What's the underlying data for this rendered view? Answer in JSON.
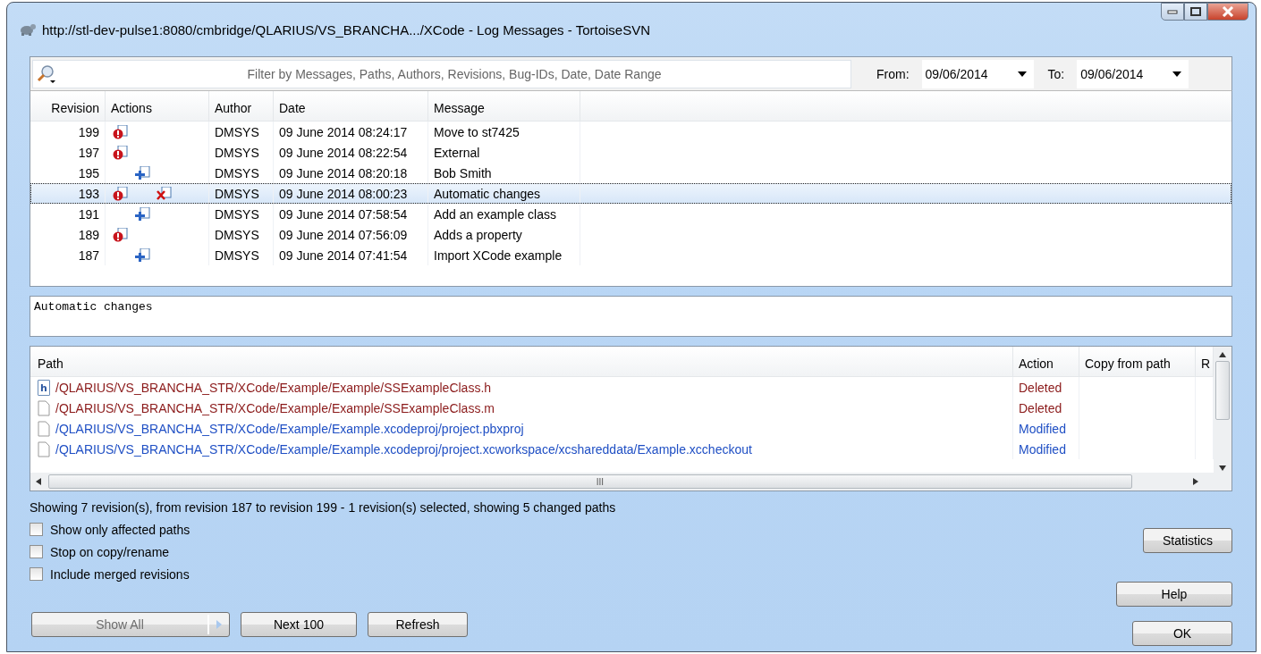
{
  "window": {
    "title": "http://stl-dev-pulse1:8080/cmbridge/QLARIUS/VS_BRANCHA.../XCode - Log Messages - TortoiseSVN"
  },
  "filter": {
    "placeholder": "Filter by Messages, Paths, Authors, Revisions, Bug-IDs, Date, Date Range"
  },
  "from": {
    "label": "From:",
    "value": "09/06/2014"
  },
  "to": {
    "label": "To:",
    "value": "09/06/2014"
  },
  "revisions": {
    "columns": [
      "Revision",
      "Actions",
      "Author",
      "Date",
      "Message"
    ],
    "rows": [
      {
        "revision": "199",
        "modified": true,
        "added": false,
        "deleted": false,
        "author": "DMSYS",
        "date": "09 June 2014 08:24:17",
        "message": "Move to st7425",
        "selected": false
      },
      {
        "revision": "197",
        "modified": true,
        "added": false,
        "deleted": false,
        "author": "DMSYS",
        "date": "09 June 2014 08:22:54",
        "message": "External",
        "selected": false
      },
      {
        "revision": "195",
        "modified": false,
        "added": true,
        "deleted": false,
        "author": "DMSYS",
        "date": "09 June 2014 08:20:18",
        "message": "Bob Smith",
        "selected": false
      },
      {
        "revision": "193",
        "modified": true,
        "added": false,
        "deleted": true,
        "author": "DMSYS",
        "date": "09 June 2014 08:00:23",
        "message": "Automatic changes",
        "selected": true
      },
      {
        "revision": "191",
        "modified": false,
        "added": true,
        "deleted": false,
        "author": "DMSYS",
        "date": "09 June 2014 07:58:54",
        "message": "Add an example class",
        "selected": false
      },
      {
        "revision": "189",
        "modified": true,
        "added": false,
        "deleted": false,
        "author": "DMSYS",
        "date": "09 June 2014 07:56:09",
        "message": "Adds a property",
        "selected": false
      },
      {
        "revision": "187",
        "modified": false,
        "added": true,
        "deleted": false,
        "author": "DMSYS",
        "date": "09 June 2014 07:41:54",
        "message": "Import XCode example",
        "selected": false
      }
    ]
  },
  "log_message": "Automatic changes",
  "paths": {
    "columns": [
      "Path",
      "Action",
      "Copy from path",
      "R"
    ],
    "rows": [
      {
        "icon_text": "h",
        "path": "/QLARIUS/VS_BRANCHA_STR/XCode/Example/Example/SSExampleClass.h",
        "action": "Deleted",
        "kind": "deleted"
      },
      {
        "path": "/QLARIUS/VS_BRANCHA_STR/XCode/Example/Example/SSExampleClass.m",
        "action": "Deleted",
        "kind": "deleted"
      },
      {
        "path": "/QLARIUS/VS_BRANCHA_STR/XCode/Example/Example.xcodeproj/project.pbxproj",
        "action": "Modified",
        "kind": "modified"
      },
      {
        "path": "/QLARIUS/VS_BRANCHA_STR/XCode/Example/Example.xcodeproj/project.xcworkspace/xcshareddata/Example.xccheckout",
        "action": "Modified",
        "kind": "modified"
      }
    ],
    "scroll_grip": "III"
  },
  "status": "Showing 7 revision(s), from revision 187 to revision 199 - 1 revision(s) selected, showing 5 changed paths",
  "options": [
    {
      "label": "Show only affected paths",
      "checked": false
    },
    {
      "label": "Stop on copy/rename",
      "checked": false
    },
    {
      "label": "Include merged revisions",
      "checked": false
    }
  ],
  "buttons_left": [
    {
      "label": "Show All",
      "disabled": true,
      "kind": "split"
    },
    {
      "label": "Next 100",
      "disabled": false,
      "kind": "plain"
    },
    {
      "label": "Refresh",
      "disabled": false,
      "kind": "plain"
    }
  ],
  "buttons_right": {
    "statistics": "Statistics",
    "help": "Help",
    "ok": "OK"
  }
}
